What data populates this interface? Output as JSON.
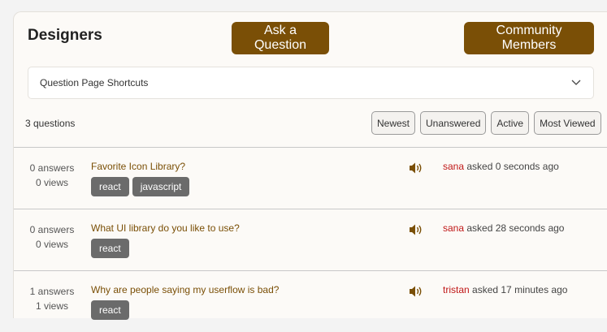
{
  "header": {
    "title": "Designers",
    "ask_label": "Ask a Question",
    "community_label": "Community Members"
  },
  "shortcuts": {
    "label": "Question Page Shortcuts"
  },
  "list": {
    "count_label": "3 questions",
    "filters": [
      "Newest",
      "Unanswered",
      "Active",
      "Most Viewed"
    ]
  },
  "questions": [
    {
      "answers": "0 answers",
      "views": "0 views",
      "title": "Favorite Icon Library?",
      "tags": [
        "react",
        "javascript"
      ],
      "user": "sana",
      "time": "asked 0 seconds ago"
    },
    {
      "answers": "0 answers",
      "views": "0 views",
      "title": "What UI library do you like to use?",
      "tags": [
        "react"
      ],
      "user": "sana",
      "time": "asked 28 seconds ago"
    },
    {
      "answers": "1 answers",
      "views": "1 views",
      "title": "Why are people saying my userflow is bad?",
      "tags": [
        "react"
      ],
      "user": "tristan",
      "time": "asked 17 minutes ago"
    }
  ],
  "colors": {
    "accent": "#7a4f06",
    "user": "#c01818",
    "tag": "#6b6b6b"
  },
  "icons": {
    "shortcuts": "chevron-down-icon",
    "audio": "speaker-icon"
  }
}
